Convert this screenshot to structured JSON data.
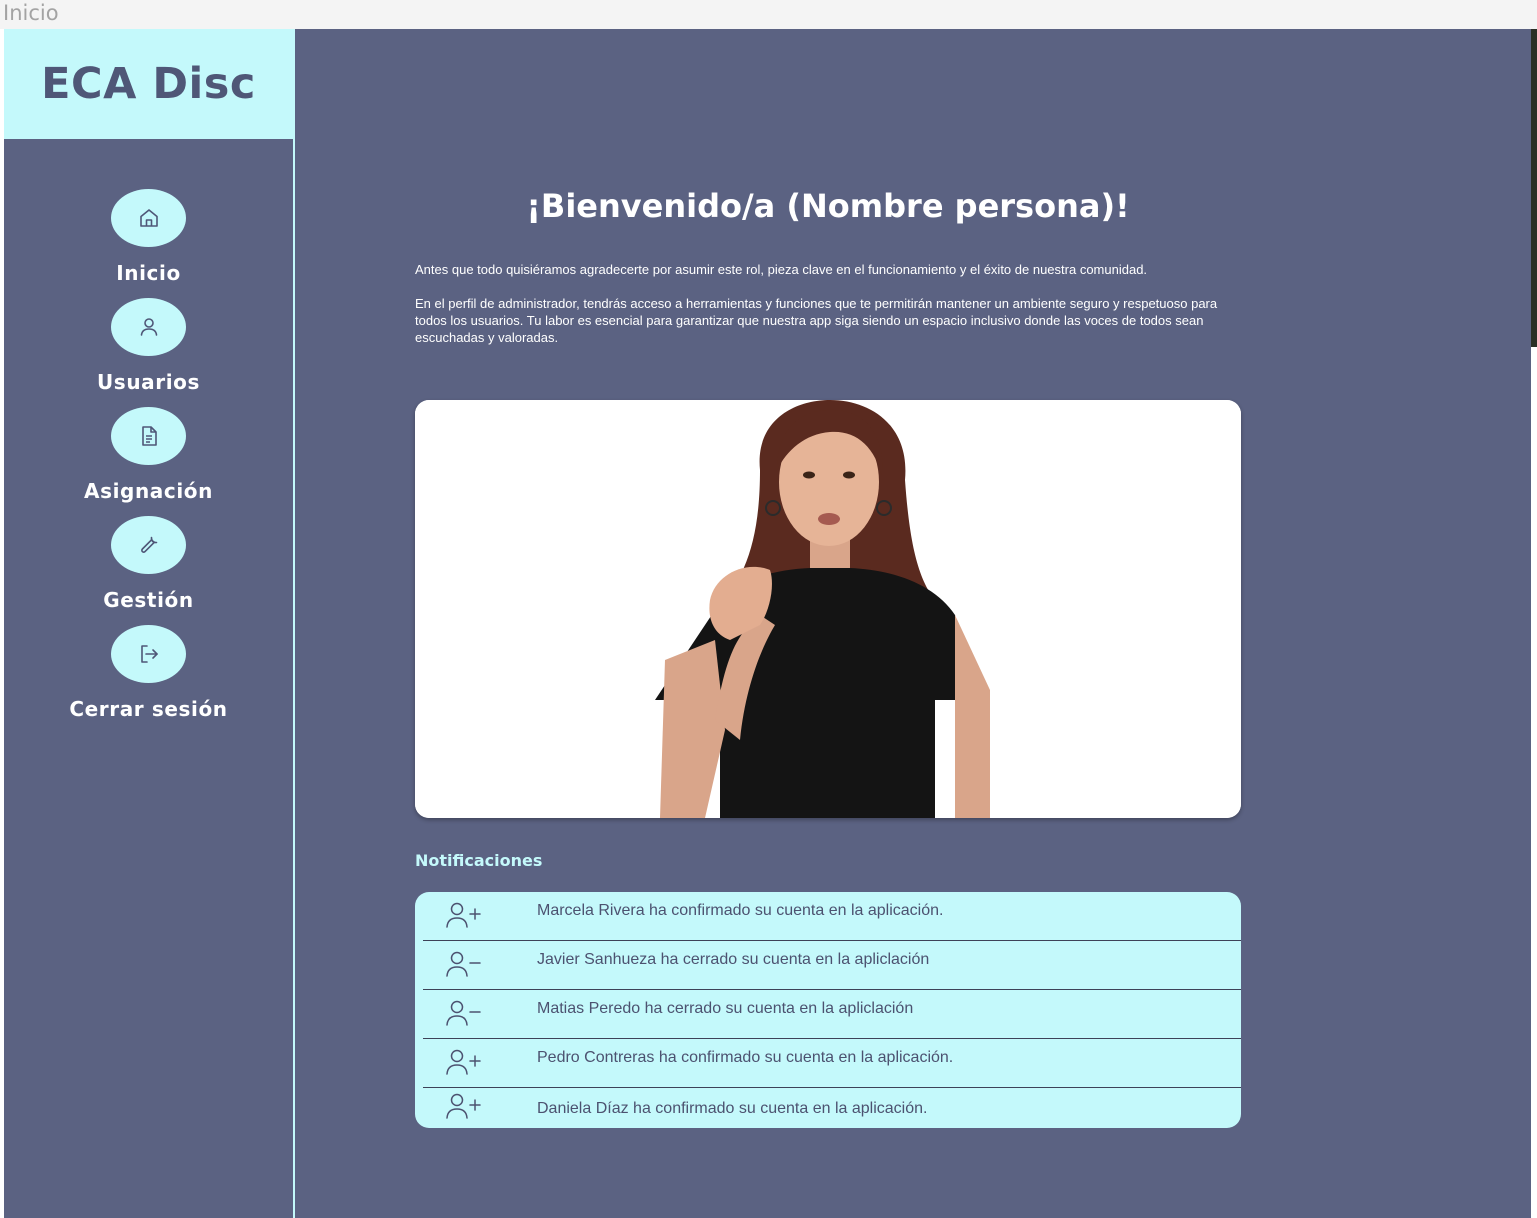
{
  "window": {
    "title": "Inicio"
  },
  "sidebar": {
    "logo": "ECA Disc",
    "items": [
      {
        "label": "Inicio",
        "icon": "home-icon"
      },
      {
        "label": "Usuarios",
        "icon": "user-icon"
      },
      {
        "label": "Asignación",
        "icon": "document-icon"
      },
      {
        "label": "Gestión",
        "icon": "wrench-icon"
      },
      {
        "label": "Cerrar sesión",
        "icon": "logout-icon"
      }
    ]
  },
  "main": {
    "welcome": "¡Bienvenido/a (Nombre persona)!",
    "intro": [
      "Antes que todo quisiéramos agradecerte por asumir este rol, pieza clave en el funcionamiento y el éxito de nuestra comunidad.",
      "En el perfil de administrador, tendrás acceso a herramientas y funciones  que te permitirán mantener un ambiente seguro y respetuoso para todos los usuarios. Tu labor es esencial para garantizar que nuestra app siga siendo un espacio inclusivo donde las voces de todos sean escuchadas y valoradas."
    ],
    "notifications_title": "Notificaciones",
    "notifications": [
      {
        "icon": "user-plus-icon",
        "text": "Marcela Rivera ha confirmado su cuenta en la aplicación."
      },
      {
        "icon": "user-minus-icon",
        "text": "Javier Sanhueza ha cerrado su cuenta en la apliclación"
      },
      {
        "icon": "user-minus-icon",
        "text": "Matias Peredo ha cerrado su cuenta en la apliclación"
      },
      {
        "icon": "user-plus-icon",
        "text": "Pedro Contreras ha confirmado su cuenta en la aplicación."
      },
      {
        "icon": "user-plus-icon",
        "text": "Daniela Díaz ha confirmado su cuenta en la aplicación."
      }
    ]
  },
  "colors": {
    "background": "#5b6282",
    "accent": "#c4f9fb",
    "text_dark": "#4c5270"
  }
}
